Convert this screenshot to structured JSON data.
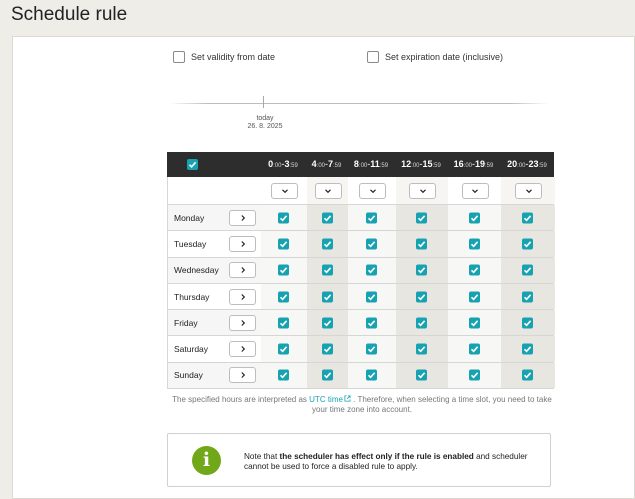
{
  "page": {
    "title": "Schedule rule"
  },
  "validity": {
    "from_label": "Set validity from date",
    "expiration_label": "Set expiration date (inclusive)",
    "today_label": "today",
    "today_date": "26. 8. 2025"
  },
  "grid": {
    "columns": [
      {
        "start": "0",
        "start_min": ":00",
        "end": "3",
        "end_min": ":59"
      },
      {
        "start": "4",
        "start_min": ":00",
        "end": "7",
        "end_min": ":59"
      },
      {
        "start": "8",
        "start_min": ":00",
        "end": "11",
        "end_min": ":59"
      },
      {
        "start": "12",
        "start_min": ":00",
        "end": "15",
        "end_min": ":59"
      },
      {
        "start": "16",
        "start_min": ":00",
        "end": "19",
        "end_min": ":59"
      },
      {
        "start": "20",
        "start_min": ":00",
        "end": "23",
        "end_min": ":59"
      }
    ],
    "days": [
      "Monday",
      "Tuesday",
      "Wednesday",
      "Thursday",
      "Friday",
      "Saturday",
      "Sunday"
    ],
    "all_checked": true,
    "cells_checked": true
  },
  "note": {
    "prefix": "The specified hours are interpreted as",
    "link": "UTC time",
    "suffix": ". Therefore, when selecting a time slot, you need to take your time zone into account."
  },
  "info": {
    "icon": "i",
    "text_1": "Note that ",
    "text_bold": "the scheduler has effect only if the rule is enabled",
    "text_2": " and scheduler cannot be used to force a disabled rule to apply."
  },
  "colors": {
    "accent": "#17a2b2",
    "header_bg": "#2d2d2d",
    "info_green": "#71a81a"
  }
}
